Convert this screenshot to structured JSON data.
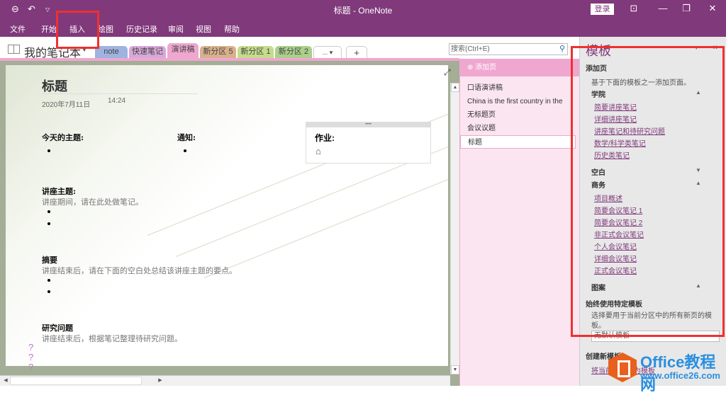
{
  "titlebar": {
    "title": "标题 - OneNote",
    "login_label": "登录",
    "icons": [
      "back-icon",
      "undo-icon",
      "customize-qat-icon",
      "ribbon-display-icon",
      "minimize-icon",
      "restore-icon",
      "close-icon"
    ]
  },
  "menu": {
    "items": [
      "文件",
      "开始",
      "插入",
      "绘图",
      "历史记录",
      "审阅",
      "视图",
      "帮助"
    ]
  },
  "notebook": {
    "name": "我的笔记本",
    "tabs": [
      {
        "label": "note",
        "color": "#9fb3e0"
      },
      {
        "label": "快速笔记",
        "color": "#d8a8d8"
      },
      {
        "label": "演讲稿",
        "color": "#efa7d0",
        "active": true
      },
      {
        "label": "新分区 5",
        "color": "#d9b08c"
      },
      {
        "label": "新分区 1",
        "color": "#c4dc8c"
      },
      {
        "label": "新分区 2",
        "color": "#aad08a"
      },
      {
        "label": "... ▾",
        "color": "#ffffff"
      },
      {
        "label": "+",
        "color": "#ffffff"
      }
    ]
  },
  "search": {
    "placeholder": "搜索(Ctrl+E)"
  },
  "page": {
    "title": "标题",
    "date": "2020年7月11日",
    "time": "14:24",
    "today_topic": "今天的主题:",
    "notice": "通知:",
    "homework": "作业:",
    "lecture_topic": "讲座主题:",
    "lecture_hint": "讲座期间，请在此处做笔记。",
    "summary": "摘要",
    "summary_hint": "讲座结束后，请在下面的空白处总结该讲座主题的要点。",
    "research": "研究问题",
    "research_hint": "讲座结束后，根据笔记整理待研究问题。",
    "question_mark": "?"
  },
  "pagelist": {
    "add_page": "添加页",
    "pages": [
      "口语演讲稿",
      "China is the first country in the",
      "无标题页",
      "会议议题",
      "标题"
    ],
    "active_index": 4
  },
  "templates": {
    "title": "模板",
    "add_page_heading": "添加页",
    "add_page_desc": "基于下面的模板之一添加页面。",
    "categories": [
      {
        "name": "学院",
        "expanded": true,
        "items": [
          "简要讲座笔记",
          "详细讲座笔记",
          "讲座笔记和待研究问题",
          "数学/科学类笔记",
          "历史类笔记"
        ]
      },
      {
        "name": "空白",
        "expanded": false,
        "items": []
      },
      {
        "name": "商务",
        "expanded": true,
        "items": [
          "项目概述",
          "简要会议笔记 1",
          "简要会议笔记 2",
          "非正式会议笔记",
          "个人会议笔记",
          "详细会议笔记",
          "正式会议笔记"
        ]
      },
      {
        "name": "图案",
        "expanded": true,
        "items": []
      }
    ],
    "always_use_heading": "始终使用特定模板",
    "always_use_desc": "选择要用于当前分区中的所有新页的模板。",
    "default_select": "无默认模板",
    "create_heading": "创建新模板",
    "create_link": "将当前页另存为模板"
  },
  "watermark": {
    "line1": "Office教程网",
    "line2": "www.office26.com"
  },
  "colors": {
    "brand": "#80397b",
    "section": "#efa7d0",
    "highlight": "#f03030"
  }
}
